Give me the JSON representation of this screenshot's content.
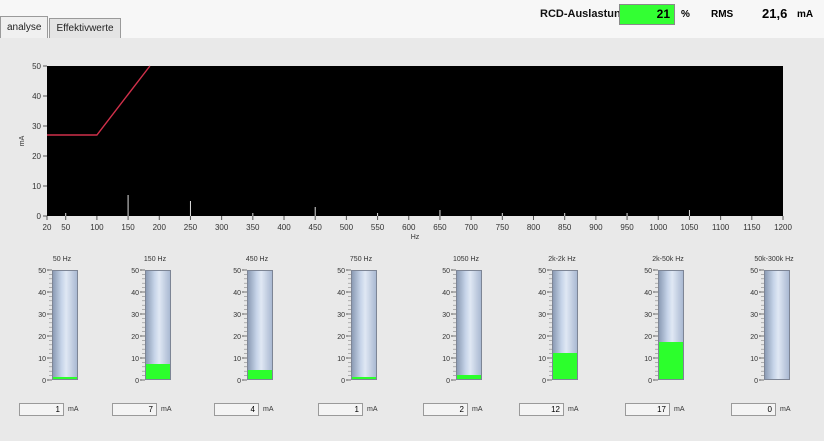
{
  "tabs": [
    {
      "label": "analyse",
      "active": true
    },
    {
      "label": "Effektivwerte",
      "active": false
    }
  ],
  "rcd": {
    "label": "RCD-Auslastung",
    "value": "21",
    "unit": "%",
    "color": "#33ff33"
  },
  "rms": {
    "label": "RMS",
    "value": "21,6",
    "unit": "mA"
  },
  "chart_data": {
    "type": "line",
    "xlabel": "Hz",
    "ylabel": "mA",
    "xlim": [
      20,
      1200
    ],
    "ylim": [
      0,
      50
    ],
    "xticks": [
      20,
      50,
      100,
      150,
      200,
      250,
      300,
      350,
      400,
      450,
      500,
      550,
      600,
      650,
      700,
      750,
      800,
      850,
      900,
      950,
      1000,
      1050,
      1100,
      1150,
      1200
    ],
    "yticks": [
      0,
      10,
      20,
      30,
      40,
      50
    ],
    "grid": false,
    "background": "#000000",
    "series": [
      {
        "type": "line",
        "color": "#d0304a",
        "x": [
          20,
          100,
          185
        ],
        "y": [
          27,
          27,
          50
        ]
      },
      {
        "type": "spectrum",
        "color": "#dddddd",
        "x": [
          50,
          150,
          250,
          350,
          450,
          550,
          650,
          750,
          850,
          950,
          1050,
          1150
        ],
        "y": [
          1,
          7,
          5,
          1,
          3,
          1,
          2,
          1,
          1,
          1,
          2,
          0
        ]
      }
    ]
  },
  "gauges": [
    {
      "title": "50 Hz",
      "value": 1,
      "display": "1",
      "unit": "mA"
    },
    {
      "title": "150 Hz",
      "value": 7,
      "display": "7",
      "unit": "mA"
    },
    {
      "title": "450 Hz",
      "value": 4,
      "display": "4",
      "unit": "mA"
    },
    {
      "title": "750 Hz",
      "value": 1,
      "display": "1",
      "unit": "mA"
    },
    {
      "title": "1050 Hz",
      "value": 2,
      "display": "2",
      "unit": "mA"
    },
    {
      "title": "2k-2k Hz",
      "value": 12,
      "display": "12",
      "unit": "mA"
    },
    {
      "title": "2k-50k Hz",
      "value": 17,
      "display": "17",
      "unit": "mA"
    },
    {
      "title": "50k-300k Hz",
      "value": 0,
      "display": "0",
      "unit": "mA"
    }
  ],
  "gauge_scale": {
    "max": 50,
    "ticks": [
      0,
      10,
      20,
      30,
      40,
      50
    ]
  }
}
